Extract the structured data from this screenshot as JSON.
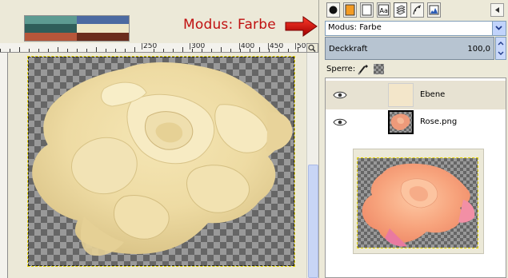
{
  "annotation": {
    "label": "Modus: Farbe",
    "arrow_icon": "right-arrow-icon",
    "color": "#c01010"
  },
  "swatches": {
    "colors": [
      "#5d9b92",
      "#4c6aa1",
      "#2f5e5a",
      "#eee6c6",
      "#b7563a",
      "#6b2c1c"
    ]
  },
  "ruler": {
    "labels": [
      "|250",
      "|300",
      "|400",
      "|450",
      "|50"
    ]
  },
  "dock": {
    "tabs": [
      "brush-tab",
      "pattern-tab",
      "gradient-tab",
      "text-tab",
      "layers-tab",
      "channels-tab",
      "paths-tab"
    ],
    "menu_icon": "dock-menu-icon"
  },
  "layers_panel": {
    "mode_label": "Modus: Farbe",
    "opacity_label": "Deckkraft",
    "opacity_value": "100,0",
    "lock_label": "Sperre:",
    "layers": [
      {
        "name": "Ebene",
        "visible": true,
        "selected": true,
        "thumb_color": "#f3e6ca"
      },
      {
        "name": "Rose.png",
        "visible": true,
        "selected": false,
        "thumb_color": "#e8987c"
      }
    ]
  },
  "colors": {
    "rose_tint": "#f0e2b0",
    "rose_original": "#f7a77e",
    "checker_dark": "#666666",
    "checker_light": "#999999",
    "selection": "#e7e2d2"
  }
}
